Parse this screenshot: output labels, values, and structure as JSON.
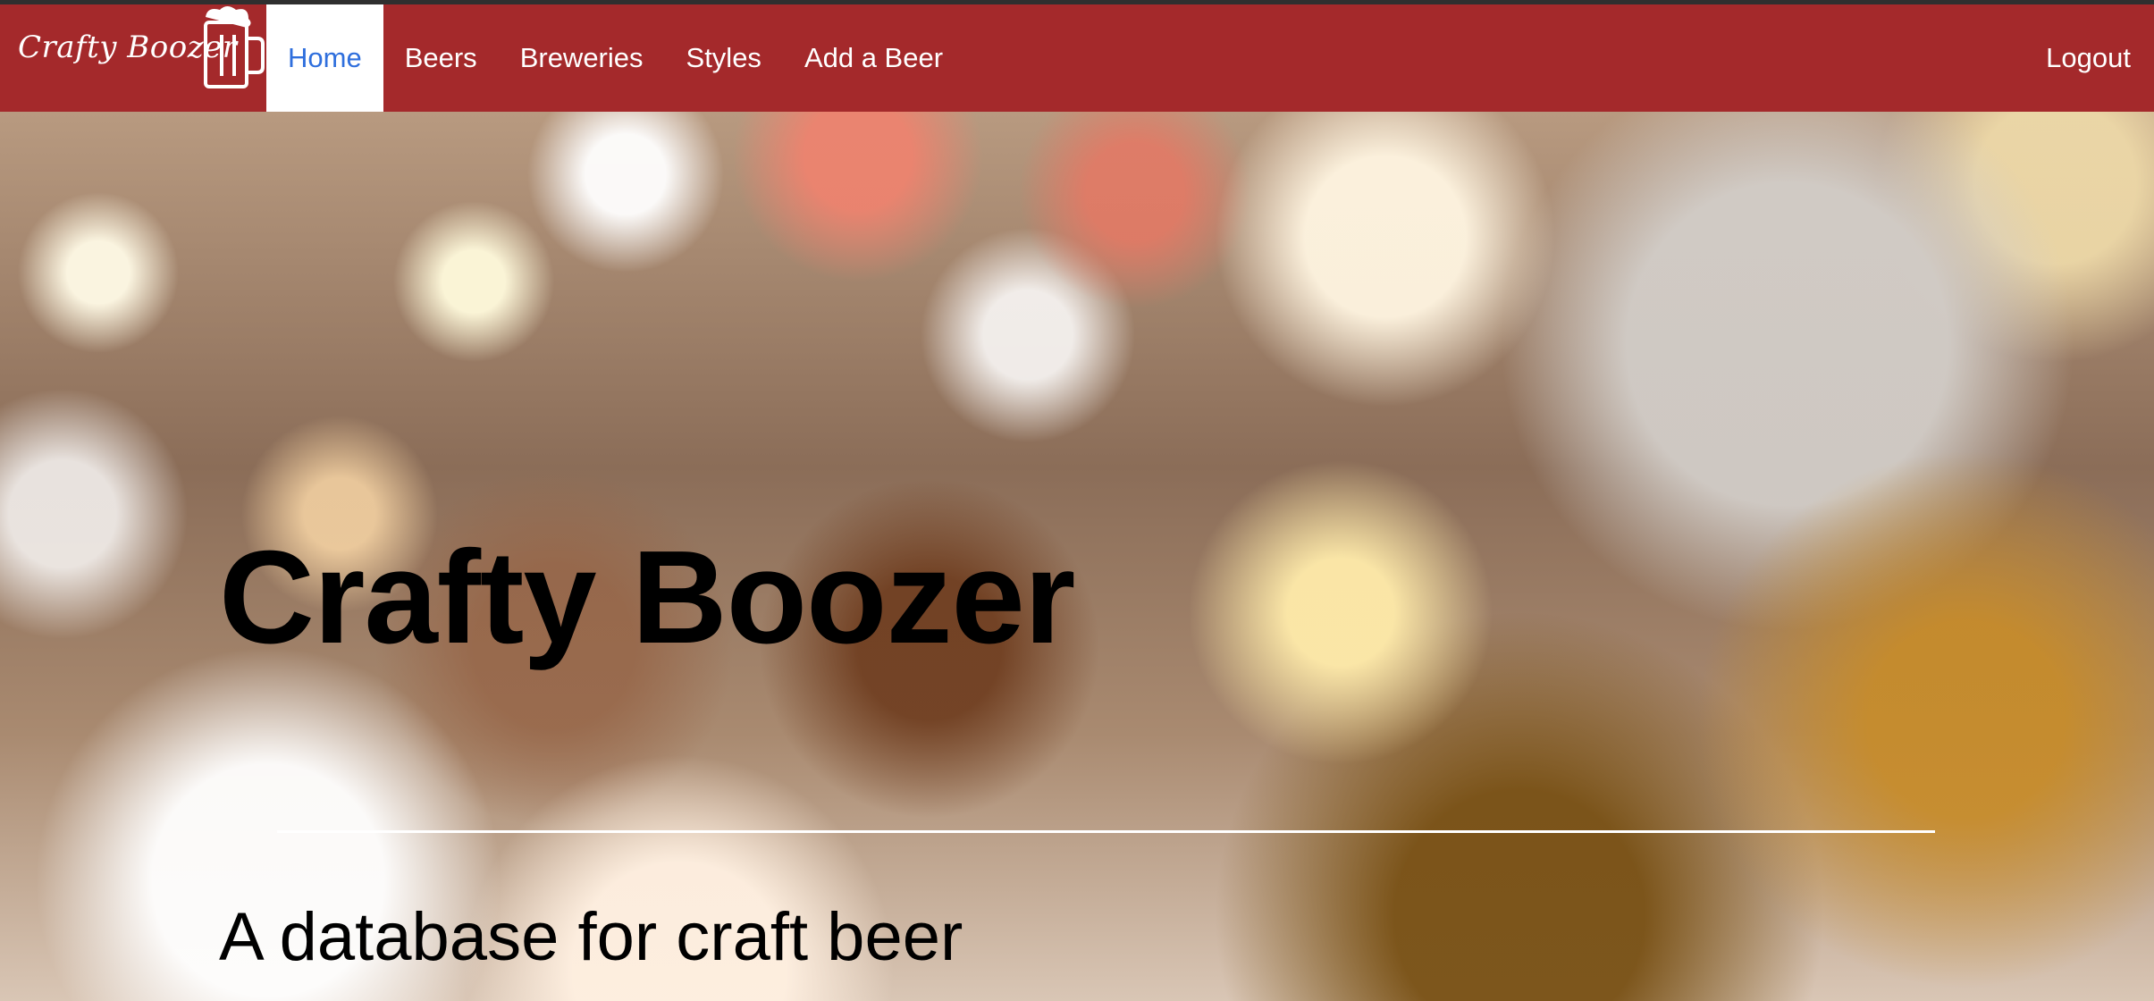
{
  "brand": {
    "name": "Crafty Boozer",
    "icon": "beer-mug-icon"
  },
  "nav": {
    "items": [
      {
        "label": "Home",
        "active": true
      },
      {
        "label": "Beers",
        "active": false
      },
      {
        "label": "Breweries",
        "active": false
      },
      {
        "label": "Styles",
        "active": false
      },
      {
        "label": "Add a Beer",
        "active": false
      }
    ],
    "logout_label": "Logout"
  },
  "hero": {
    "title": "Crafty Boozer",
    "subtitle": "A database for craft beer"
  },
  "colors": {
    "navbar_bg": "#a4292b",
    "active_link": "#2f6fdd",
    "nav_text": "#ffffff"
  }
}
